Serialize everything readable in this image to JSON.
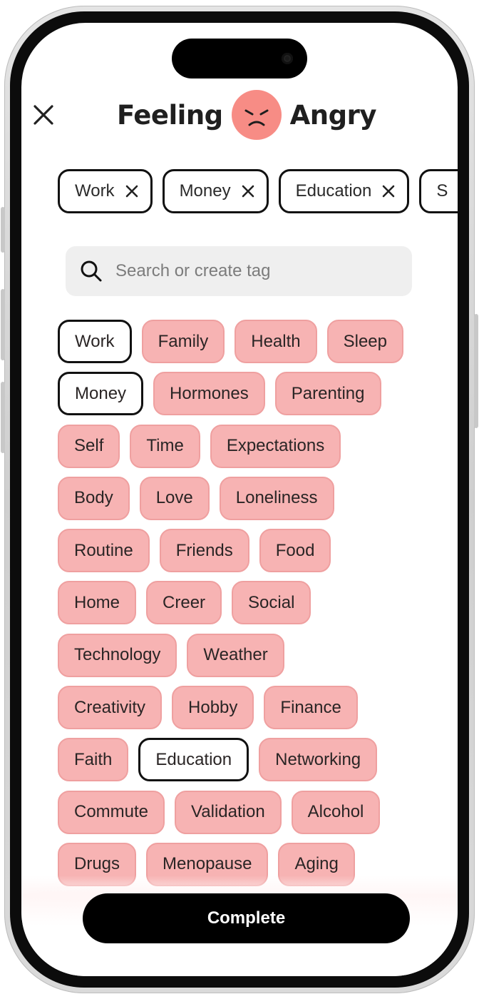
{
  "header": {
    "title_before": "Feeling",
    "title_after": "Angry",
    "mood_emoji": "angry-face-icon",
    "mood_color": "#f78c85"
  },
  "selected_tags": [
    {
      "label": "Work"
    },
    {
      "label": "Money"
    },
    {
      "label": "Education"
    },
    {
      "label": "S"
    }
  ],
  "search": {
    "placeholder": "Search or create tag",
    "value": ""
  },
  "tag_rows": [
    [
      {
        "label": "Work",
        "selected": true
      },
      {
        "label": "Family"
      },
      {
        "label": "Health"
      },
      {
        "label": "Sleep"
      }
    ],
    [
      {
        "label": "Money",
        "selected": true
      },
      {
        "label": "Hormones"
      },
      {
        "label": "Parenting"
      }
    ],
    [
      {
        "label": "Self"
      },
      {
        "label": "Time"
      },
      {
        "label": "Expectations"
      }
    ],
    [
      {
        "label": "Body"
      },
      {
        "label": "Love"
      },
      {
        "label": "Loneliness"
      }
    ],
    [
      {
        "label": "Routine"
      },
      {
        "label": "Friends"
      },
      {
        "label": "Food"
      }
    ],
    [
      {
        "label": "Home"
      },
      {
        "label": "Creer"
      },
      {
        "label": "Social"
      }
    ],
    [
      {
        "label": "Technology"
      },
      {
        "label": "Weather"
      }
    ],
    [
      {
        "label": "Creativity"
      },
      {
        "label": "Hobby"
      },
      {
        "label": "Finance"
      }
    ],
    [
      {
        "label": "Faith"
      },
      {
        "label": "Education",
        "selected": true
      },
      {
        "label": "Networking"
      }
    ],
    [
      {
        "label": "Commute"
      },
      {
        "label": "Validation"
      },
      {
        "label": "Alcohol"
      }
    ],
    [
      {
        "label": "Drugs"
      },
      {
        "label": "Menopause"
      },
      {
        "label": "Aging"
      }
    ]
  ],
  "colors": {
    "tag_fill": "#f7b3b3",
    "tag_border": "#efa0a0",
    "selected_border": "#111111",
    "button_bg": "#000000"
  },
  "footer": {
    "complete_label": "Complete"
  }
}
